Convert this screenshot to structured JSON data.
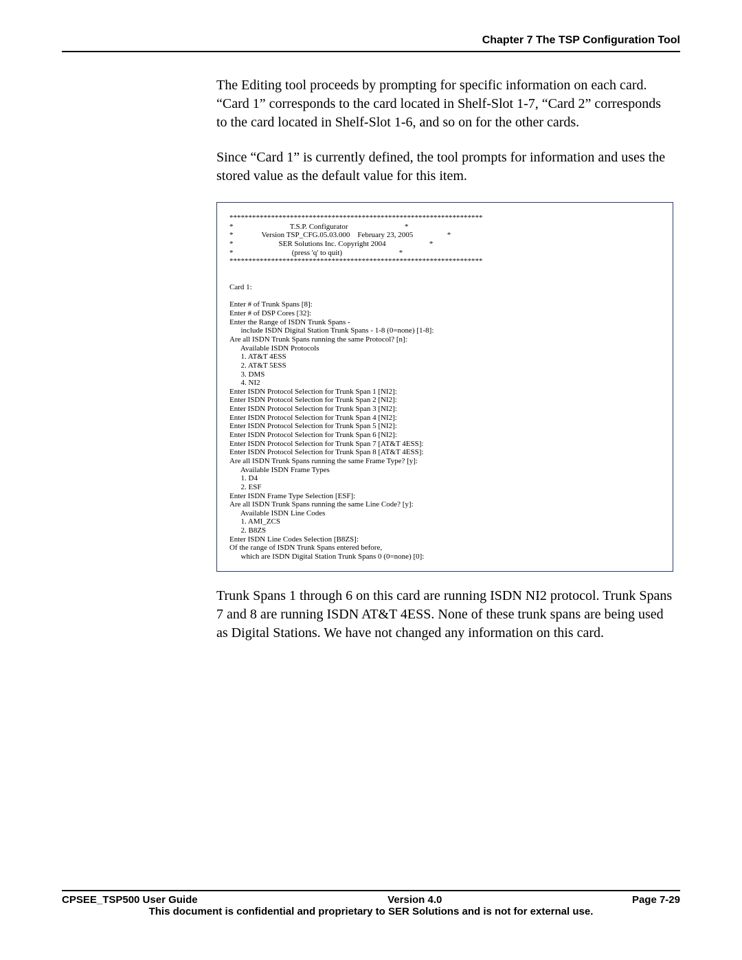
{
  "chapter_header": "Chapter 7 The TSP Configuration Tool",
  "body": {
    "p1": "The Editing tool proceeds by prompting for specific information on each card.  “Card 1” corresponds to the card located in Shelf-Slot 1-7, “Card 2” corresponds to the card located in Shelf-Slot 1-6, and so on for the other cards.",
    "p2": "Since “Card 1” is currently defined, the tool prompts for information and uses the stored value as the default value for this item.",
    "p3": "Trunk Spans 1 through 6 on this card are running ISDN NI2 protocol. Trunk Spans 7 and 8 are running ISDN AT&T 4ESS. None of these trunk spans are being used as Digital Stations.  We have not changed any information on this card."
  },
  "terminal": "*******************************************************************\n*                              T.S.P. Configurator                              *\n*               Version TSP_CFG.05.03.000    February 23, 2005                  *\n*                        SER Solutions Inc. Copyright 2004                       *\n*                               (press 'q' to quit)                              *\n*******************************************************************\n\n\nCard 1:\n\nEnter # of Trunk Spans [8]:\nEnter # of DSP Cores [32]:\nEnter the Range of ISDN Trunk Spans -\n      include ISDN Digital Station Trunk Spans - 1-8 (0=none) [1-8]:\nAre all ISDN Trunk Spans running the same Protocol? [n]:\n      Available ISDN Protocols\n      1. AT&T 4ESS\n      2. AT&T 5ESS\n      3. DMS\n      4. NI2\nEnter ISDN Protocol Selection for Trunk Span 1 [NI2]:\nEnter ISDN Protocol Selection for Trunk Span 2 [NI2]:\nEnter ISDN Protocol Selection for Trunk Span 3 [NI2]:\nEnter ISDN Protocol Selection for Trunk Span 4 [NI2]:\nEnter ISDN Protocol Selection for Trunk Span 5 [NI2]:\nEnter ISDN Protocol Selection for Trunk Span 6 [NI2]:\nEnter ISDN Protocol Selection for Trunk Span 7 [AT&T 4ESS]:\nEnter ISDN Protocol Selection for Trunk Span 8 [AT&T 4ESS]:\nAre all ISDN Trunk Spans running the same Frame Type? [y]:\n      Available ISDN Frame Types\n      1. D4\n      2. ESF\nEnter ISDN Frame Type Selection [ESF]:\nAre all ISDN Trunk Spans running the same Line Code? [y]:\n      Available ISDN Line Codes\n      1. AMI_ZCS\n      2. B8ZS\nEnter ISDN Line Codes Selection [B8ZS]:\nOf the range of ISDN Trunk Spans entered before,\n      which are ISDN Digital Station Trunk Spans 0 (0=none) [0]:",
  "footer": {
    "left": "CPSEE_TSP500 User Guide",
    "center": "Version 4.0",
    "right": "Page 7-29",
    "conf": "This document is confidential and proprietary to SER Solutions and is not for external use."
  }
}
